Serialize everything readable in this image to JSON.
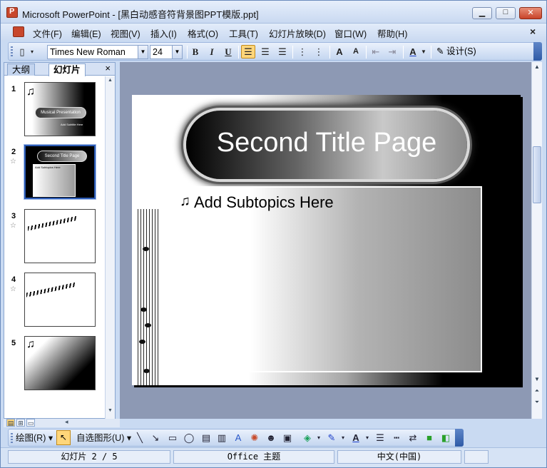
{
  "window": {
    "title": "Microsoft PowerPoint - [黑白动感音符背景图PPT模版.ppt]"
  },
  "menu": {
    "items": [
      "文件(F)",
      "编辑(E)",
      "视图(V)",
      "插入(I)",
      "格式(O)",
      "工具(T)",
      "幻灯片放映(D)",
      "窗口(W)",
      "帮助(H)"
    ],
    "close_glyph": "×"
  },
  "toolbar": {
    "font_name": "Times New Roman",
    "font_size": "24",
    "design_label": "设计(S)",
    "icons": [
      "bold-icon",
      "italic-icon",
      "underline-icon",
      "align-left-icon",
      "align-center-icon",
      "align-right-icon",
      "numbering-icon",
      "bullets-icon",
      "increase-font-icon",
      "decrease-font-icon",
      "promote-icon",
      "demote-icon",
      "font-color-icon",
      "design-icon"
    ]
  },
  "left_pane": {
    "tab_outline": "大纲",
    "tab_slides": "幻灯片",
    "close_glyph": "×",
    "thumbnails": [
      {
        "num": "1",
        "label": "Musical Presentation",
        "sub": "Add Subtitle Here",
        "has_star": false
      },
      {
        "num": "2",
        "label": "Second Title Page",
        "sub": "Add Subtopics Here",
        "has_star": true
      },
      {
        "num": "3",
        "has_star": true
      },
      {
        "num": "4",
        "has_star": true
      },
      {
        "num": "5",
        "has_star": false
      }
    ],
    "selected_index": 2
  },
  "slide": {
    "title": "Second Title Page",
    "bullet_glyph": "♫",
    "body": "Add Subtopics Here"
  },
  "drawbar": {
    "draw_label": "绘图(R)",
    "autoshape_label": "自选图形(U)"
  },
  "status": {
    "slide_pos": "幻灯片 2 / 5",
    "theme": "Office 主题",
    "language": "中文(中国)"
  },
  "colors": {
    "chrome": "#c9daf2",
    "canvas": "#8d99b4",
    "selection": "#2c5bb5",
    "highlight": "#ffd67a"
  }
}
